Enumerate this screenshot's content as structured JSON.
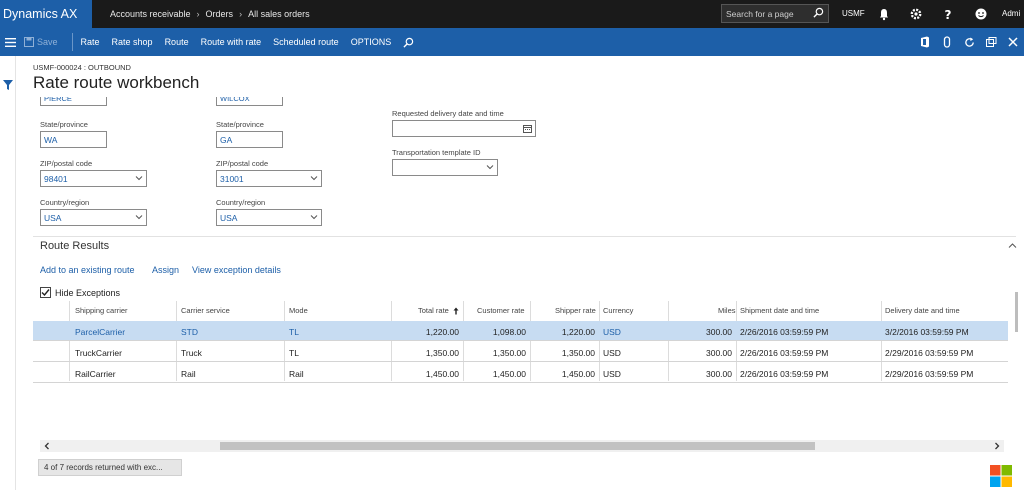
{
  "topbar": {
    "brand": "Dynamics AX",
    "breadcrumbs": [
      "Accounts receivable",
      "Orders",
      "All sales orders"
    ],
    "search_placeholder": "Search for a page",
    "company": "USMF",
    "user": "Admi"
  },
  "actions": {
    "save": "Save",
    "items": [
      "Rate",
      "Rate shop",
      "Route",
      "Route with rate",
      "Scheduled route",
      "OPTIONS"
    ]
  },
  "page": {
    "subtitle": "USMF-000024 : OUTBOUND",
    "title": "Rate route workbench"
  },
  "origin": {
    "city_value": "PIERCE",
    "state_label": "State/province",
    "state_value": "WA",
    "zip_label": "ZIP/postal code",
    "zip_value": "98401",
    "country_label": "Country/region",
    "country_value": "USA"
  },
  "destination": {
    "city_value": "WILCOX",
    "state_label": "State/province",
    "state_value": "GA",
    "zip_label": "ZIP/postal code",
    "zip_value": "31001",
    "country_label": "Country/region",
    "country_value": "USA"
  },
  "other": {
    "delivery_label": "Requested delivery date and time",
    "delivery_value": "",
    "template_label": "Transportation template ID",
    "template_value": ""
  },
  "results": {
    "section_title": "Route Results",
    "links": [
      "Add to an existing route",
      "Assign",
      "View exception details"
    ],
    "hide_exceptions_label": "Hide Exceptions",
    "hide_exceptions_checked": true,
    "columns": [
      "Shipping carrier",
      "Carrier service",
      "Mode",
      "Total rate",
      "Customer rate",
      "Shipper rate",
      "Currency",
      "Miles",
      "Shipment date and time",
      "Delivery date and time"
    ],
    "rows": [
      {
        "carrier": "ParcelCarrier",
        "service": "STD",
        "mode": "TL",
        "total": "1,220.00",
        "customer": "1,098.00",
        "shipper": "1,220.00",
        "currency": "USD",
        "miles": "300.00",
        "ship": "2/26/2016 03:59:59 PM",
        "delivery": "3/2/2016 03:59:59 PM",
        "selected": true
      },
      {
        "carrier": "TruckCarrier",
        "service": "Truck",
        "mode": "TL",
        "total": "1,350.00",
        "customer": "1,350.00",
        "shipper": "1,350.00",
        "currency": "USD",
        "miles": "300.00",
        "ship": "2/26/2016 03:59:59 PM",
        "delivery": "2/29/2016 03:59:59 PM",
        "selected": false
      },
      {
        "carrier": "RailCarrier",
        "service": "Rail",
        "mode": "Rail",
        "total": "1,450.00",
        "customer": "1,450.00",
        "shipper": "1,450.00",
        "currency": "USD",
        "miles": "300.00",
        "ship": "2/26/2016 03:59:59 PM",
        "delivery": "2/29/2016 03:59:59 PM",
        "selected": false
      }
    ],
    "status": "4 of 7 records returned with exc..."
  },
  "colors": {
    "brand_blue": "#1d5fa8",
    "topbar": "#1a1a1a",
    "selected_row": "#c7dcf2"
  },
  "icons": [
    "hamburger-icon",
    "save-icon",
    "search-icon",
    "bell-icon",
    "gear-icon",
    "help-icon",
    "user-icon",
    "office-icon",
    "attach-icon",
    "refresh-icon",
    "popout-icon",
    "close-icon",
    "filter-icon",
    "calendar-icon",
    "chevron-down-icon",
    "chevron-up-icon",
    "sort-up-icon",
    "windows-logo-icon"
  ]
}
